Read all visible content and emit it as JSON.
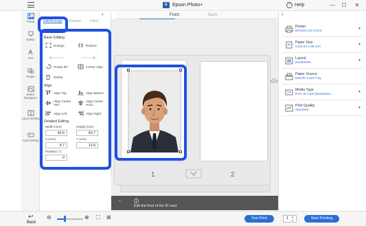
{
  "window": {
    "title": "Epson Photo+",
    "help_label": "Help",
    "logo_text": "E",
    "min_glyph": "—",
    "max_glyph": "☐",
    "close_glyph": "✕"
  },
  "toolrail": {
    "items": [
      {
        "label": "Photo",
        "icon": "photo-icon"
      },
      {
        "label": "Stamp",
        "icon": "stamp-icon"
      },
      {
        "label": "Text",
        "icon": "text-icon",
        "glyph": "A"
      },
      {
        "label": "Shape",
        "icon": "shape-icon"
      },
      {
        "label": "Select Backgrou",
        "icon": "background-icon"
      },
      {
        "label": "Layou Setting",
        "icon": "layout-icon"
      },
      {
        "label": "Card Setting",
        "icon": "card-icon"
      }
    ]
  },
  "editpanel": {
    "tabs": [
      "Edit/Arrange",
      "Shadow",
      "Effect"
    ],
    "collapse_glyph": "‹",
    "basic_editing": {
      "title": "Basic Editing",
      "items": [
        "Enlarge",
        "Reduce",
        "Rotate 90°",
        "Center Align",
        "Delete"
      ]
    },
    "align": {
      "title": "Align",
      "items": [
        "Align Top",
        "Align Bottom",
        "Align Center Vert.",
        "Align Center Horiz.",
        "Align Left",
        "Align Right"
      ]
    },
    "detailed_editing": {
      "title": "Detailed Editing",
      "width_label": "Width (mm)",
      "width_value": "42.6",
      "height_label": "Height (mm)",
      "height_value": "60.7",
      "x_label": "X (mm)",
      "x_value": "5.7",
      "y_label": "Y (mm)",
      "y_value": "12.6",
      "rotation_label": "Rotation (°)",
      "rotation_value": "0"
    }
  },
  "canvas": {
    "view_tabs": [
      "Front",
      "Back"
    ],
    "active_tab": "Front",
    "pages": [
      "1",
      "2"
    ],
    "hint": "Edit the front of the ID card.",
    "hint_collapse_glyph": "⌄"
  },
  "settings": {
    "collapse_glyph": "›",
    "items": [
      {
        "title": "Printer",
        "value": "EPSON XX-XXXX",
        "icon": "printer-icon"
      },
      {
        "title": "Paper Size",
        "value": "Card 54 x 86 mm",
        "icon": "paper-size-icon"
      },
      {
        "title": "Layout",
        "value": "Borderless",
        "icon": "layout-icon"
      },
      {
        "title": "Paper Source",
        "value": "Disc/ID Card Tray",
        "icon": "paper-source-icon"
      },
      {
        "title": "Media Type",
        "value": "PVC ID Card (Borderles...",
        "icon": "media-type-icon"
      },
      {
        "title": "Print Quality",
        "value": "Standard",
        "icon": "print-quality-icon"
      }
    ]
  },
  "bottombar": {
    "back_label": "Back",
    "back_glyph": "↩",
    "zoom_minus": "⊖",
    "zoom_plus": "⊕",
    "zoom_level": 0.3,
    "fit_glyph": "⛶",
    "grid_glyph": "⊞",
    "test_print_label": "Test Print",
    "copies_value": "1",
    "start_printing_label": "Start Printing"
  },
  "colors": {
    "accent": "#2b6fd6",
    "highlight": "#1e50e0",
    "hint_bar": "#555555"
  }
}
